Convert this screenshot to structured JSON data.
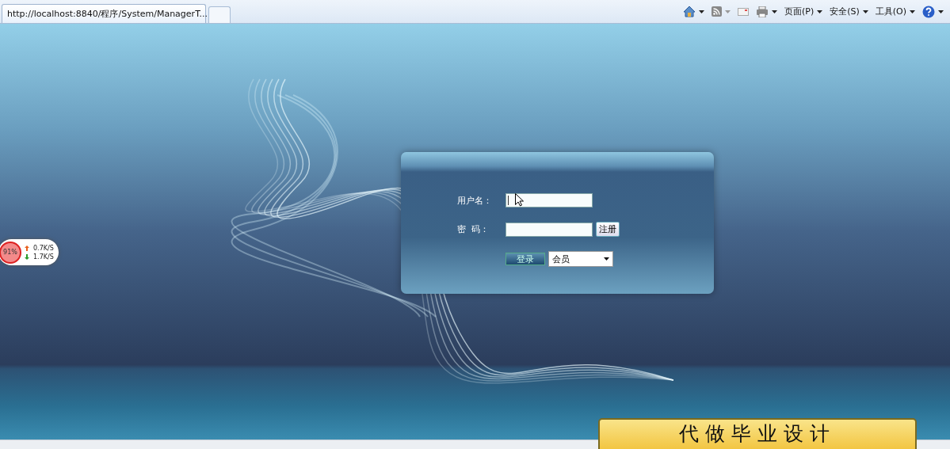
{
  "browser": {
    "tab_title": "http://localhost:8840/程序/System/ManagerT...",
    "menus": [
      "页面(P)",
      "安全(S)",
      "工具(O)"
    ]
  },
  "login": {
    "username_label": "用户名：",
    "password_label": "密  码：",
    "register_button": "注册",
    "login_button": "登录",
    "role_select": "会员"
  },
  "net_widget": {
    "percent": "91%",
    "upload": "0.7K/S",
    "download": "1.7K/S"
  },
  "ad_banner": "代做毕业设计"
}
